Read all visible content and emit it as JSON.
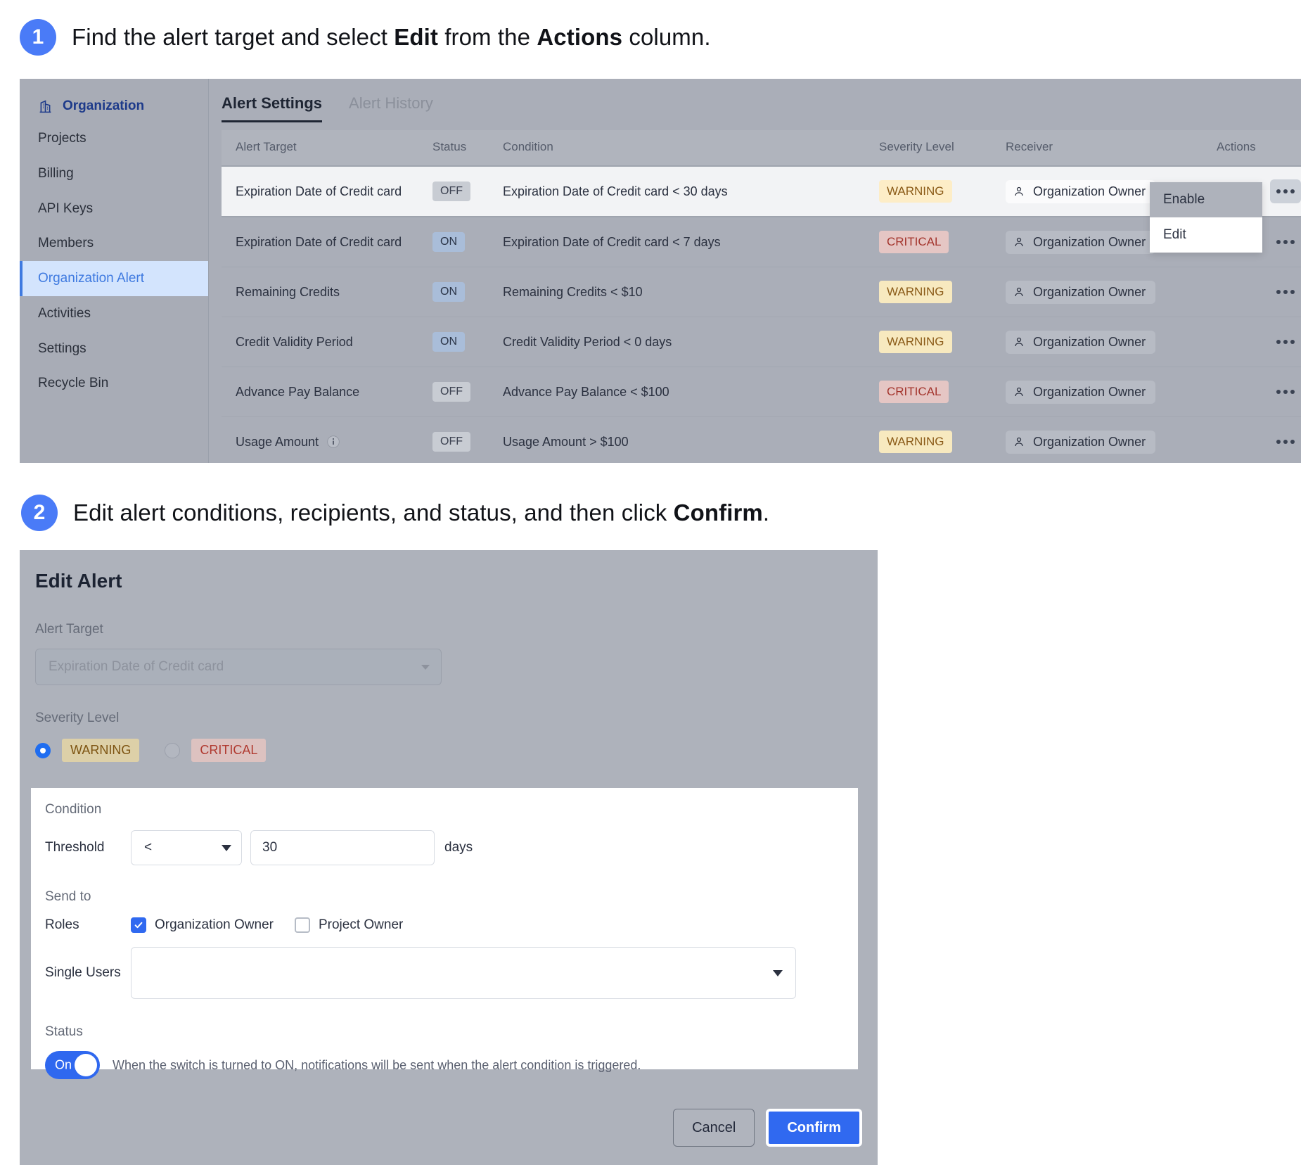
{
  "steps": [
    {
      "number": "1",
      "pre": "Find the alert target and select ",
      "b1": "Edit",
      "mid": " from the ",
      "b2": "Actions",
      "post": " column."
    },
    {
      "number": "2",
      "pre": "Edit alert conditions, recipients, and status, and then click ",
      "b1": "Confirm",
      "mid": ".",
      "b2": "",
      "post": ""
    }
  ],
  "sidebar": {
    "header": "Organization",
    "header_icon": "organization-building-icon",
    "items": [
      {
        "label": "Projects",
        "active": false
      },
      {
        "label": "Billing",
        "active": false
      },
      {
        "label": "API Keys",
        "active": false
      },
      {
        "label": "Members",
        "active": false
      },
      {
        "label": "Organization Alert",
        "active": true
      },
      {
        "label": "Activities",
        "active": false
      },
      {
        "label": "Settings",
        "active": false
      },
      {
        "label": "Recycle Bin",
        "active": false
      }
    ]
  },
  "tabs": [
    {
      "label": "Alert Settings",
      "active": true
    },
    {
      "label": "Alert History",
      "active": false
    }
  ],
  "table": {
    "headers": [
      "Alert Target",
      "Status",
      "Condition",
      "Severity Level",
      "Receiver",
      "Actions"
    ],
    "rows": [
      {
        "target": "Expiration Date of Credit card",
        "info_icon": false,
        "status": "OFF",
        "condition": "Expiration Date of Credit card < 30 days",
        "severity": "WARNING",
        "receiver": "Organization Owner",
        "highlighted": true
      },
      {
        "target": "Expiration Date of Credit card",
        "info_icon": false,
        "status": "ON",
        "condition": "Expiration Date of Credit card < 7 days",
        "severity": "CRITICAL",
        "receiver": "Organization Owner",
        "highlighted": false
      },
      {
        "target": "Remaining Credits",
        "info_icon": false,
        "status": "ON",
        "condition": "Remaining Credits < $10",
        "severity": "WARNING",
        "receiver": "Organization Owner",
        "highlighted": false
      },
      {
        "target": "Credit Validity Period",
        "info_icon": false,
        "status": "ON",
        "condition": "Credit Validity Period < 0 days",
        "severity": "WARNING",
        "receiver": "Organization Owner",
        "highlighted": false
      },
      {
        "target": "Advance Pay Balance",
        "info_icon": false,
        "status": "OFF",
        "condition": "Advance Pay Balance < $100",
        "severity": "CRITICAL",
        "receiver": "Organization Owner",
        "highlighted": false
      },
      {
        "target": "Usage Amount",
        "info_icon": true,
        "status": "OFF",
        "condition": "Usage Amount > $100",
        "severity": "WARNING",
        "receiver": "Organization Owner",
        "highlighted": false
      }
    ]
  },
  "actions_menu": {
    "items": [
      {
        "label": "Enable",
        "highlighted": false
      },
      {
        "label": "Edit",
        "highlighted": true
      }
    ]
  },
  "dialog": {
    "title": "Edit Alert",
    "alert_target": {
      "label": "Alert Target",
      "value": "Expiration Date of Credit card",
      "disabled": true
    },
    "severity": {
      "label": "Severity Level",
      "options": [
        {
          "label": "WARNING",
          "selected": true
        },
        {
          "label": "CRITICAL",
          "selected": false
        }
      ]
    },
    "condition": {
      "label": "Condition",
      "threshold_label": "Threshold",
      "operator": "<",
      "value": "30",
      "unit": "days"
    },
    "send_to": {
      "label": "Send to",
      "roles_label": "Roles",
      "roles": [
        {
          "label": "Organization Owner",
          "checked": true
        },
        {
          "label": "Project Owner",
          "checked": false
        }
      ],
      "single_users_label": "Single Users",
      "single_users_value": ""
    },
    "status": {
      "label": "Status",
      "toggle_label": "On",
      "toggle_on": true,
      "note": "When the switch is turned to ON, notifications will be sent when the alert condition is triggered."
    },
    "buttons": {
      "cancel": "Cancel",
      "confirm": "Confirm"
    }
  },
  "colors": {
    "accent_blue": "#3069f0",
    "warning": "#8a5a17",
    "critical": "#a3342c",
    "active_nav": "#3f7ae0"
  }
}
